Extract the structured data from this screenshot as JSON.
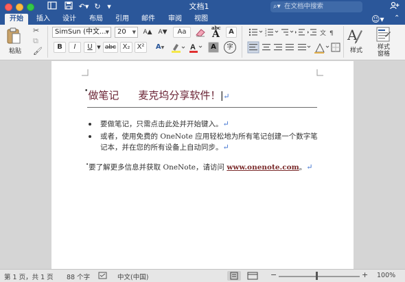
{
  "window": {
    "title": "文档1",
    "search_placeholder": "在文档中搜索"
  },
  "quick_access": {
    "sidebar_icon": "panel-icon",
    "save_icon": "save-icon",
    "undo_icon": "undo-icon",
    "redo_icon": "redo-icon",
    "more_icon": "more-icon"
  },
  "tabs": [
    {
      "label": "开始",
      "active": true
    },
    {
      "label": "插入",
      "active": false
    },
    {
      "label": "设计",
      "active": false
    },
    {
      "label": "布局",
      "active": false
    },
    {
      "label": "引用",
      "active": false
    },
    {
      "label": "邮件",
      "active": false
    },
    {
      "label": "审阅",
      "active": false
    },
    {
      "label": "视图",
      "active": false
    }
  ],
  "ribbon": {
    "paste_label": "粘贴",
    "font_name": "SimSun (中文...",
    "font_size": "20",
    "bold": "B",
    "italic": "I",
    "underline": "U",
    "strikethrough": "abc",
    "subscript": "X₂",
    "superscript": "X²",
    "grow_font": "A▲",
    "shrink_font": "A▼",
    "change_case": "Aa",
    "phonetic": "文",
    "char_border": "A",
    "text_effect": "A",
    "char_shading": "A",
    "enclose_char": "字",
    "styles_label": "样式",
    "styles_pane_label": "样式\n窗格",
    "accent_color": "#2b579a",
    "font_color": "#e03030",
    "highlight_color": "#f5e84a"
  },
  "document": {
    "heading_part1": "做笔记",
    "heading_part2": "麦克坞分享软件！",
    "bullets": [
      "要做笔记，只需点击此处并开始键入。",
      "或者，使用免费的 OneNote 应用轻松地为所有笔记创建一个数字笔记本，并在您的所有设备上自动同步。"
    ],
    "note_prefix": "要了解更多信息并获取 OneNote，请访问 ",
    "note_link": "www.onenote.com",
    "note_suffix": "。",
    "para_mark": "↵",
    "heading_color": "#6a2334",
    "link_color": "#7a2a2a"
  },
  "status": {
    "page": "第 1 页，共 1 页",
    "words": "88 个字",
    "language": "中文(中国)",
    "zoom": "100%"
  }
}
